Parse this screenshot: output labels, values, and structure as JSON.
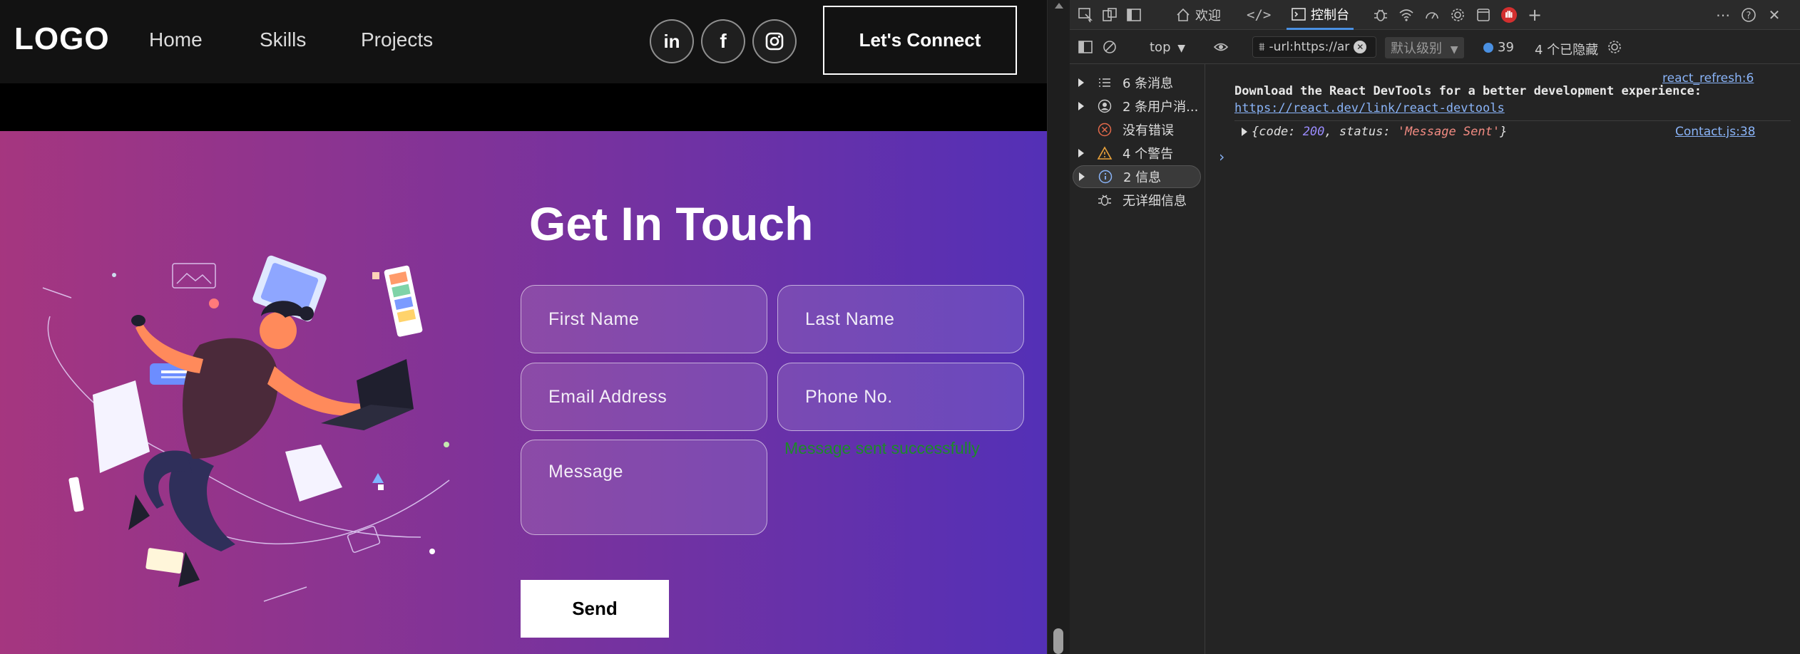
{
  "site": {
    "logo": "LOGO",
    "nav": [
      "Home",
      "Skills",
      "Projects"
    ],
    "social": [
      "linkedin-icon",
      "facebook-icon",
      "instagram-icon"
    ],
    "connect_label": "Let's Connect",
    "contact": {
      "heading": "Get In Touch",
      "placeholders": {
        "first_name": "First Name",
        "last_name": "Last Name",
        "email": "Email Address",
        "phone": "Phone No.",
        "message": "Message"
      },
      "status": "Message sent successfully",
      "send_label": "Send",
      "gradient": [
        "#AA367C",
        "#4A2FBD"
      ],
      "status_color": "#1d8a29"
    }
  },
  "devtools": {
    "tabs": {
      "welcome": "欢迎",
      "console": "控制台"
    },
    "toolbar": {
      "context": "top",
      "filter_text": "-url:https://ar",
      "level": "默认级别",
      "issues_count": "39",
      "hidden": "4 个已隐藏"
    },
    "sidebar": [
      {
        "label": "6 条消息",
        "icon": "list-icon",
        "expandable": true
      },
      {
        "label": "2 条用户消...",
        "icon": "user-icon",
        "expandable": true
      },
      {
        "label": "没有错误",
        "icon": "error-icon",
        "expandable": false
      },
      {
        "label": "4 个警告",
        "icon": "warning-icon",
        "expandable": true
      },
      {
        "label": "2 信息",
        "icon": "info-icon",
        "expandable": true,
        "selected": true
      },
      {
        "label": "无详细信息",
        "icon": "bug-icon",
        "expandable": false
      }
    ],
    "console": {
      "source1": "react_refresh:6",
      "message1": "Download the React DevTools for a better development experience:",
      "message1_url": "https://react.dev/link/react-devtools",
      "source2": "Contact.js:38",
      "log": {
        "open": "{",
        "code_key": "code",
        "code_value": "200",
        "status_key": "status",
        "status_value": "'Message Sent'",
        "close": "}"
      },
      "prompt": "›"
    }
  }
}
